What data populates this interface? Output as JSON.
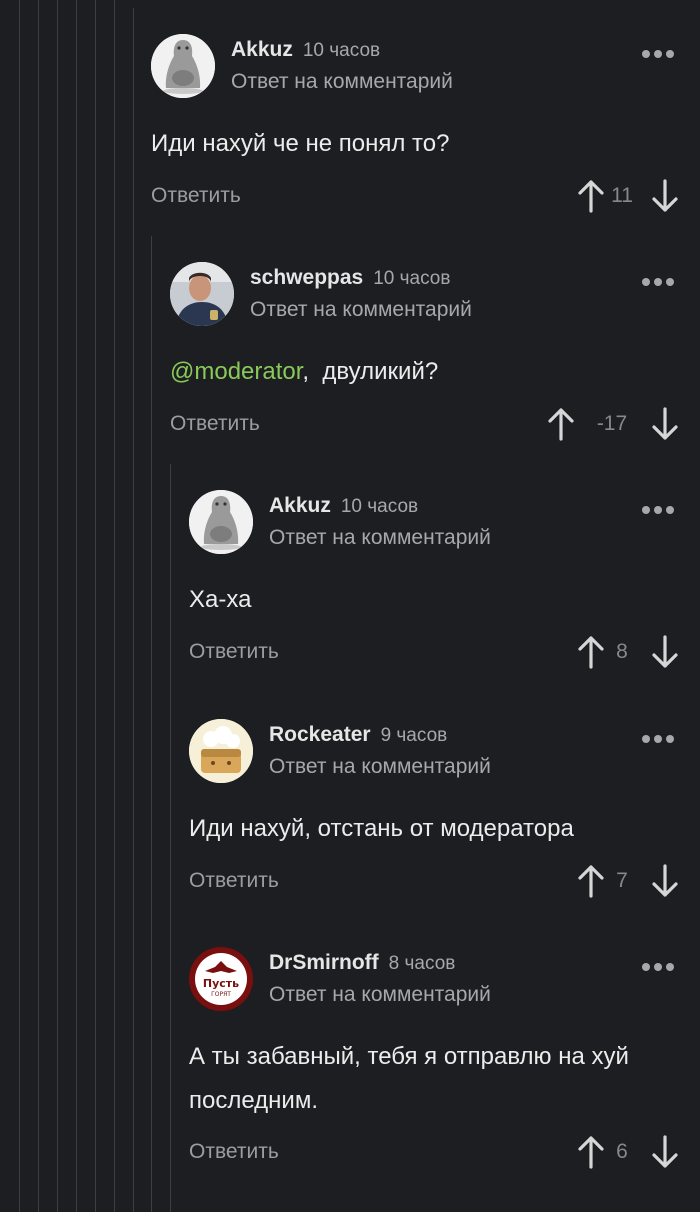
{
  "reply_note": "Ответ на комментарий",
  "reply_label": "Ответить",
  "colors": {
    "background": "#1c1e21",
    "mention": "#8ac858",
    "muted": "#a5a8ad"
  },
  "comments": [
    {
      "author": "Akkuz",
      "time": "10 часов",
      "avatar": "seal-avatar-icon",
      "text": "Иди нахуй че не понял то?",
      "score": "11"
    },
    {
      "author": "schweppas",
      "time": "10 часов",
      "avatar": "policeman-photo-avatar",
      "mention": "@moderator",
      "text_after": ",  двуликий?",
      "score": "-17"
    },
    {
      "author": "Akkuz",
      "time": "10 часов",
      "avatar": "seal-avatar-icon",
      "text": "Ха-ха",
      "score": "8"
    },
    {
      "author": "Rockeater",
      "time": "9 часов",
      "avatar": "cartoon-bread-avatar-icon",
      "text": "Иди нахуй, отстань от модератора",
      "score": "7"
    },
    {
      "author": "DrSmirnoff",
      "time": "8 часов",
      "avatar": "eagle-emblem-avatar-icon",
      "avatar_text": "Пусть",
      "avatar_subtext": "ГОРЯТ",
      "text": "А ты забавный, тебя я отправлю на хуй последним.",
      "score": "6"
    }
  ]
}
